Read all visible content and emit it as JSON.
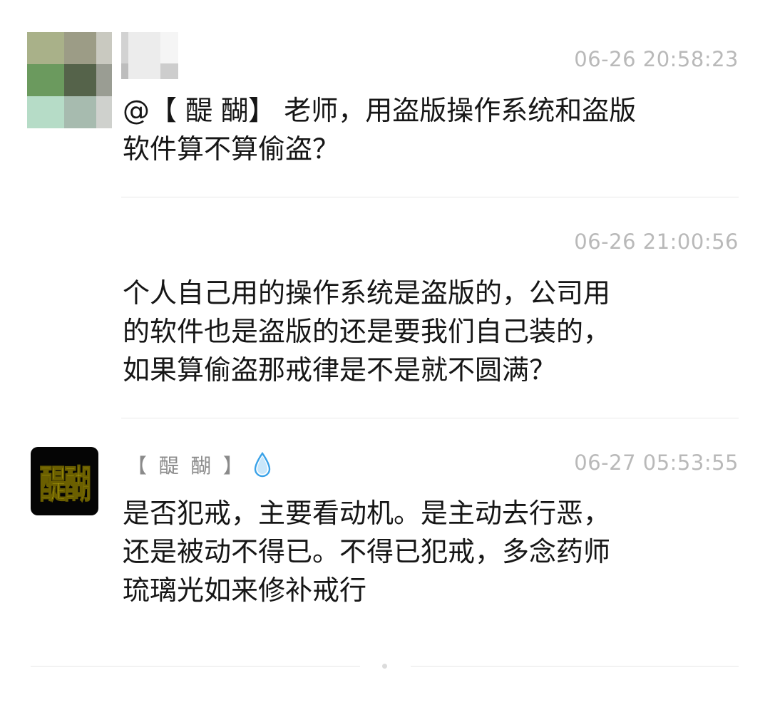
{
  "messages": [
    {
      "timestamp": "06-26 20:58:23",
      "text": "@【 醍 醐】 老师，用盗版操作系统和盗版\n软件算不算偷盗？"
    },
    {
      "timestamp": "06-26 21:00:56",
      "text": "个人自己用的操作系统是盗版的，公司用\n的软件也是盗版的还是要我们自己装的，\n如果算偷盗那戒律是不是就不圆满？"
    },
    {
      "author": "【 醍 醐 】",
      "badge_icon": "water-drop-icon",
      "avatar_text": "醍醐",
      "timestamp": "06-27 05:53:55",
      "text": "是否犯戒，主要看动机。是主动去行恶，\n还是被动不得已。不得已犯戒，多念药师\n琉璃光如来修补戒行"
    }
  ],
  "colors": {
    "timestamp": "#b9b9b9",
    "author": "#8a8a8a",
    "text": "#161616",
    "divider": "#e8e8e8",
    "drop": "#3aa2e8",
    "logo_text": "#f2e51a",
    "logo_bg": "#050505"
  }
}
